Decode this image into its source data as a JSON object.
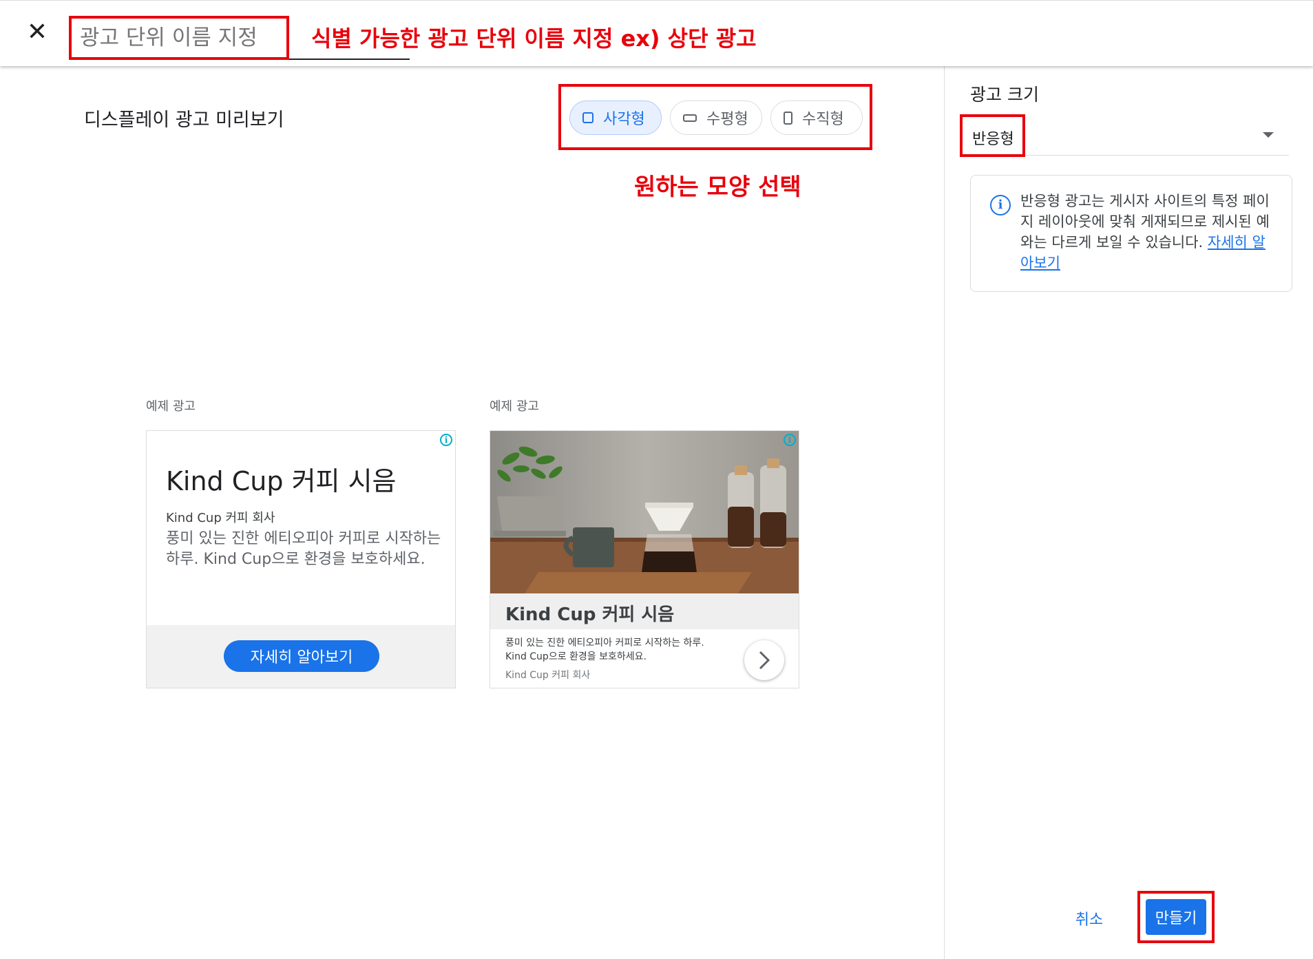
{
  "header": {
    "close_icon": "close-icon",
    "name_placeholder": "광고 단위 이름 지정",
    "annotation": "식별 가능한 광고 단위 이름 지정 ex) 상단 광고"
  },
  "preview": {
    "title": "디스플레이 광고 미리보기",
    "shapes": [
      {
        "label": "사각형",
        "icon": "square-icon",
        "selected": true
      },
      {
        "label": "수평형",
        "icon": "horizontal-rect-icon",
        "selected": false
      },
      {
        "label": "수직형",
        "icon": "vertical-rect-icon",
        "selected": false
      }
    ],
    "shape_annotation": "원하는 모양 선택"
  },
  "ads": [
    {
      "label": "예제 광고",
      "headline": "Kind Cup 커피 시음",
      "advertiser": "Kind Cup 커피 회사",
      "description": "풍미 있는 진한 에티오피아 커피로 시작하는 하루. Kind Cup으로 환경을 보호하세요.",
      "cta": "자세히 알아보기"
    },
    {
      "label": "예제 광고",
      "headline": "Kind Cup 커피 시음",
      "description": "풍미 있는 진한 에티오피아 커피로 시작하는 하루. Kind Cup으로 환경을 보호하세요.",
      "advertiser": "Kind Cup 커피 회사"
    }
  ],
  "sidebar": {
    "size_label": "광고 크기",
    "size_value": "반응형",
    "info_text": "반응형 광고는 게시자 사이트의 특정 페이지 레이아웃에 맞춰 게재되므로 제시된 예와는 다르게 보일 수 있습니다.",
    "info_link": "자세히 알아보기",
    "cancel": "취소",
    "create": "만들기"
  },
  "colors": {
    "accent": "#1a73e8",
    "annotation_red": "#e8000b",
    "adchoices": "#00aecd"
  }
}
